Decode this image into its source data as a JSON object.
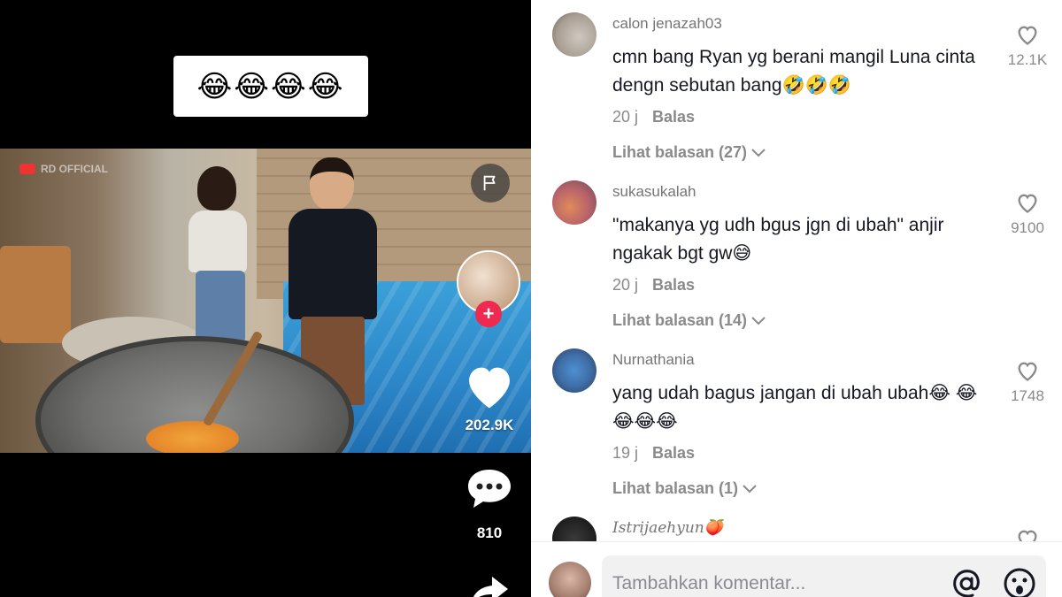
{
  "video": {
    "caption_emojis": "😂😂😂😂",
    "watermark": "RD OFFICIAL",
    "like_count": "202.9K",
    "comment_count": "810"
  },
  "comments": [
    {
      "username": "calon jenazah03",
      "text": "cmn bang Ryan yg berani mangil Luna cinta dengn sebutan bang🤣🤣🤣",
      "time": "20 j",
      "reply_label": "Balas",
      "view_replies": "Lihat balasan (27)",
      "likes": "12.1K"
    },
    {
      "username": "sukasukalah",
      "text": "\"makanya yg udh bgus jgn di ubah\" anjir ngakak bgt gw😅",
      "time": "20 j",
      "reply_label": "Balas",
      "view_replies": "Lihat balasan (14)",
      "likes": "9100"
    },
    {
      "username": "Nurnathania",
      "text": "yang udah bagus jangan di ubah ubah😂 😂😂😂😂",
      "time": "19 j",
      "reply_label": "Balas",
      "view_replies": "Lihat balasan (1)",
      "likes": "1748"
    },
    {
      "username": "Istrijaehyun🍑",
      "text": "",
      "likes": ""
    }
  ],
  "input": {
    "placeholder": "Tambahkan komentar..."
  },
  "colors": {
    "accent": "#ef2950",
    "text": "#161823",
    "muted": "#8a8a8a"
  }
}
